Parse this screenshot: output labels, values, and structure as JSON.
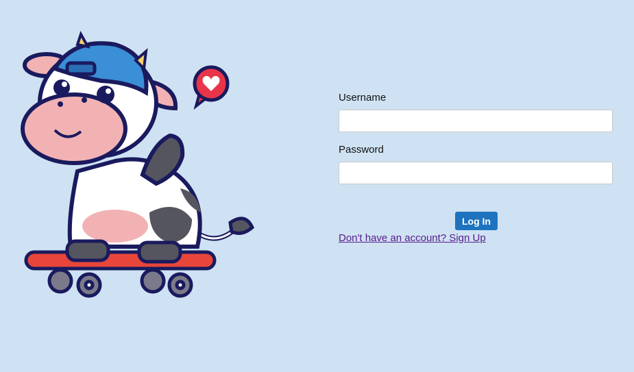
{
  "colors": {
    "background": "#cfe2f3",
    "button": "#1e73be",
    "link": "#551a8b"
  },
  "mascot": {
    "description_icon": "cow-on-skateboard-illustration"
  },
  "form": {
    "username_label": "Username",
    "username_value": "",
    "password_label": "Password",
    "password_value": "",
    "login_label": "Log In",
    "signup_text": "Don't have an account? Sign Up"
  }
}
